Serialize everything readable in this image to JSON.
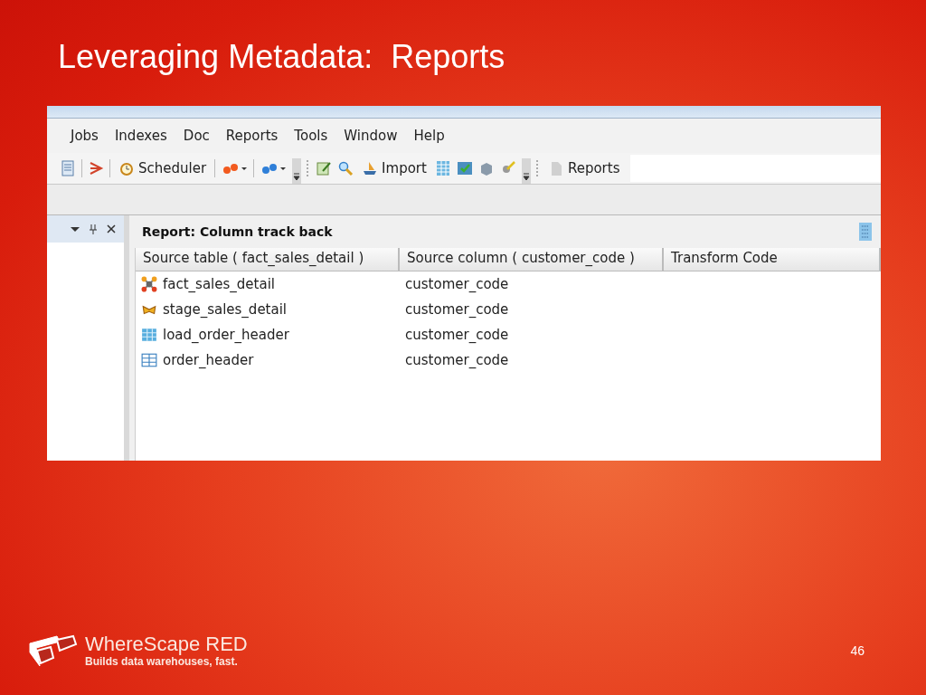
{
  "slide": {
    "title": "Leveraging Metadata:  Reports"
  },
  "menu": [
    {
      "label": "Jobs"
    },
    {
      "label": "Indexes"
    },
    {
      "label": "Doc"
    },
    {
      "label": "Reports"
    },
    {
      "label": "Tools"
    },
    {
      "label": "Window"
    },
    {
      "label": "Help"
    }
  ],
  "toolbar": {
    "scheduler": "Scheduler",
    "import": "Import",
    "reports": "Reports"
  },
  "report": {
    "title": "Report: Column track back",
    "columns": [
      "Source table ( fact_sales_detail )",
      "Source column ( customer_code )",
      "Transform Code"
    ],
    "rows": [
      {
        "kind": "fact",
        "source_table": "fact_sales_detail",
        "source_column": "customer_code"
      },
      {
        "kind": "stage",
        "source_table": "stage_sales_detail",
        "source_column": "customer_code"
      },
      {
        "kind": "load",
        "source_table": "load_order_header",
        "source_column": "customer_code"
      },
      {
        "kind": "table",
        "source_table": "order_header",
        "source_column": "customer_code"
      }
    ]
  },
  "footer": {
    "brand": "WhereScape RED",
    "tagline": "Builds data warehouses, fast.",
    "page_number": "46"
  }
}
